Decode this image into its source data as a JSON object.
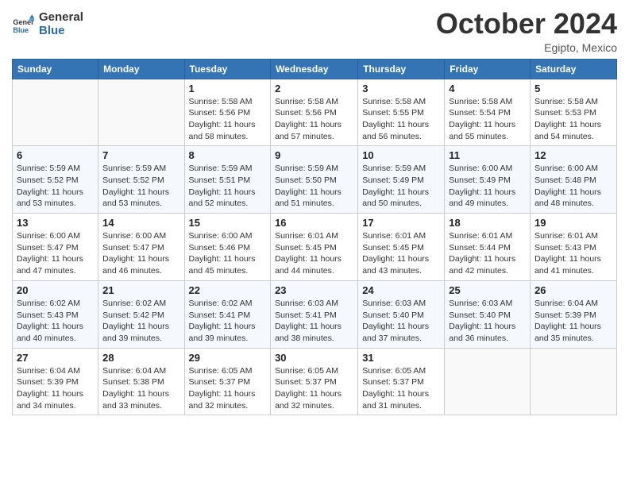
{
  "header": {
    "logo_line1": "General",
    "logo_line2": "Blue",
    "month": "October 2024",
    "location": "Egipto, Mexico"
  },
  "weekdays": [
    "Sunday",
    "Monday",
    "Tuesday",
    "Wednesday",
    "Thursday",
    "Friday",
    "Saturday"
  ],
  "weeks": [
    [
      {
        "day": "",
        "text": ""
      },
      {
        "day": "",
        "text": ""
      },
      {
        "day": "1",
        "text": "Sunrise: 5:58 AM\nSunset: 5:56 PM\nDaylight: 11 hours and 58 minutes."
      },
      {
        "day": "2",
        "text": "Sunrise: 5:58 AM\nSunset: 5:56 PM\nDaylight: 11 hours and 57 minutes."
      },
      {
        "day": "3",
        "text": "Sunrise: 5:58 AM\nSunset: 5:55 PM\nDaylight: 11 hours and 56 minutes."
      },
      {
        "day": "4",
        "text": "Sunrise: 5:58 AM\nSunset: 5:54 PM\nDaylight: 11 hours and 55 minutes."
      },
      {
        "day": "5",
        "text": "Sunrise: 5:58 AM\nSunset: 5:53 PM\nDaylight: 11 hours and 54 minutes."
      }
    ],
    [
      {
        "day": "6",
        "text": "Sunrise: 5:59 AM\nSunset: 5:52 PM\nDaylight: 11 hours and 53 minutes."
      },
      {
        "day": "7",
        "text": "Sunrise: 5:59 AM\nSunset: 5:52 PM\nDaylight: 11 hours and 53 minutes."
      },
      {
        "day": "8",
        "text": "Sunrise: 5:59 AM\nSunset: 5:51 PM\nDaylight: 11 hours and 52 minutes."
      },
      {
        "day": "9",
        "text": "Sunrise: 5:59 AM\nSunset: 5:50 PM\nDaylight: 11 hours and 51 minutes."
      },
      {
        "day": "10",
        "text": "Sunrise: 5:59 AM\nSunset: 5:49 PM\nDaylight: 11 hours and 50 minutes."
      },
      {
        "day": "11",
        "text": "Sunrise: 6:00 AM\nSunset: 5:49 PM\nDaylight: 11 hours and 49 minutes."
      },
      {
        "day": "12",
        "text": "Sunrise: 6:00 AM\nSunset: 5:48 PM\nDaylight: 11 hours and 48 minutes."
      }
    ],
    [
      {
        "day": "13",
        "text": "Sunrise: 6:00 AM\nSunset: 5:47 PM\nDaylight: 11 hours and 47 minutes."
      },
      {
        "day": "14",
        "text": "Sunrise: 6:00 AM\nSunset: 5:47 PM\nDaylight: 11 hours and 46 minutes."
      },
      {
        "day": "15",
        "text": "Sunrise: 6:00 AM\nSunset: 5:46 PM\nDaylight: 11 hours and 45 minutes."
      },
      {
        "day": "16",
        "text": "Sunrise: 6:01 AM\nSunset: 5:45 PM\nDaylight: 11 hours and 44 minutes."
      },
      {
        "day": "17",
        "text": "Sunrise: 6:01 AM\nSunset: 5:45 PM\nDaylight: 11 hours and 43 minutes."
      },
      {
        "day": "18",
        "text": "Sunrise: 6:01 AM\nSunset: 5:44 PM\nDaylight: 11 hours and 42 minutes."
      },
      {
        "day": "19",
        "text": "Sunrise: 6:01 AM\nSunset: 5:43 PM\nDaylight: 11 hours and 41 minutes."
      }
    ],
    [
      {
        "day": "20",
        "text": "Sunrise: 6:02 AM\nSunset: 5:43 PM\nDaylight: 11 hours and 40 minutes."
      },
      {
        "day": "21",
        "text": "Sunrise: 6:02 AM\nSunset: 5:42 PM\nDaylight: 11 hours and 39 minutes."
      },
      {
        "day": "22",
        "text": "Sunrise: 6:02 AM\nSunset: 5:41 PM\nDaylight: 11 hours and 39 minutes."
      },
      {
        "day": "23",
        "text": "Sunrise: 6:03 AM\nSunset: 5:41 PM\nDaylight: 11 hours and 38 minutes."
      },
      {
        "day": "24",
        "text": "Sunrise: 6:03 AM\nSunset: 5:40 PM\nDaylight: 11 hours and 37 minutes."
      },
      {
        "day": "25",
        "text": "Sunrise: 6:03 AM\nSunset: 5:40 PM\nDaylight: 11 hours and 36 minutes."
      },
      {
        "day": "26",
        "text": "Sunrise: 6:04 AM\nSunset: 5:39 PM\nDaylight: 11 hours and 35 minutes."
      }
    ],
    [
      {
        "day": "27",
        "text": "Sunrise: 6:04 AM\nSunset: 5:39 PM\nDaylight: 11 hours and 34 minutes."
      },
      {
        "day": "28",
        "text": "Sunrise: 6:04 AM\nSunset: 5:38 PM\nDaylight: 11 hours and 33 minutes."
      },
      {
        "day": "29",
        "text": "Sunrise: 6:05 AM\nSunset: 5:37 PM\nDaylight: 11 hours and 32 minutes."
      },
      {
        "day": "30",
        "text": "Sunrise: 6:05 AM\nSunset: 5:37 PM\nDaylight: 11 hours and 32 minutes."
      },
      {
        "day": "31",
        "text": "Sunrise: 6:05 AM\nSunset: 5:37 PM\nDaylight: 11 hours and 31 minutes."
      },
      {
        "day": "",
        "text": ""
      },
      {
        "day": "",
        "text": ""
      }
    ]
  ]
}
